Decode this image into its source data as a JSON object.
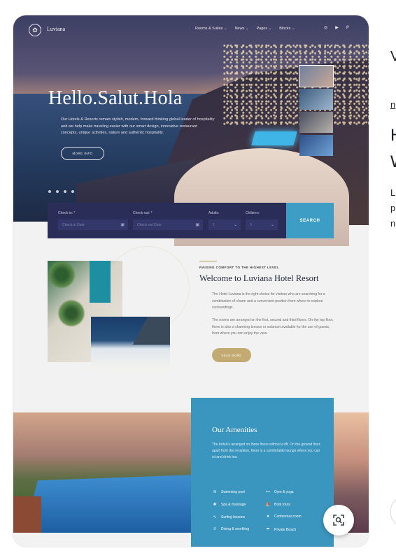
{
  "nav": {
    "logo": "Luviana",
    "items": [
      {
        "label": "Rooms & Suites ⌄"
      },
      {
        "label": "News ⌄"
      },
      {
        "label": "Pages ⌄"
      },
      {
        "label": "Blocks ⌄"
      }
    ]
  },
  "hero": {
    "title": "Hello.Salut.Hola",
    "description": "Our Hotels & Resorts remain stylish, modern, forward thinking global leader of hospitality and we help make traveling easier with our smart design, innovative restaurant concepts, unique activities, nature and authentic hospitality.",
    "more_button": "MORE INFO"
  },
  "booking": {
    "checkin_label": "Check-in: *",
    "checkin_placeholder": "Check-in Date",
    "checkout_label": "Check-out: *",
    "checkout_placeholder": "Check-out Date",
    "adults_label": "Adults:",
    "adults_value": "1",
    "children_label": "Children:",
    "children_value": "0",
    "search_button": "SEARCH"
  },
  "welcome": {
    "eyebrow": "RAISING COMFORT TO THE HIGHEST LEVEL",
    "title": "Welcome to Luviana Hotel Resort",
    "p1": "The Hotel Luviana is the right choice for visitors who are searching for a combination of charm and a convenient position from where to explore surroundings.",
    "p2": "The rooms are arranged on the first, second and third floors. On the top floor, there is also a charming terrace or solarium available for the use of guests, from where you can enjoy the view.",
    "button": "READ MORE"
  },
  "amenities": {
    "title": "Our Amenities",
    "description": "The hotel is arranged on three floors without a lift. On the ground floor, apart from the reception, there is a comfortable lounge where you can sit and drink tea.",
    "items": [
      {
        "label": "Swimming pool",
        "icon": "pool-icon"
      },
      {
        "label": "Gym & yoga",
        "icon": "dumbbell-icon"
      },
      {
        "label": "Spa & massage",
        "icon": "spa-icon"
      },
      {
        "label": "Boat tours",
        "icon": "boat-icon"
      },
      {
        "label": "Surfing lessons",
        "icon": "surf-icon"
      },
      {
        "label": "Conference room",
        "icon": "mic-icon"
      },
      {
        "label": "Diving & snorkling",
        "icon": "diving-icon"
      },
      {
        "label": "Private Beach",
        "icon": "umbrella-icon"
      }
    ]
  },
  "right_panel": {
    "line1": "V",
    "line2": "n",
    "line3": "H",
    "line4": "W",
    "line5": "L",
    "line6": "p",
    "line7": "n"
  },
  "colors": {
    "accent_blue": "#3e9dc4",
    "booking_navy": "#2a2d57",
    "gold": "#c3aa72"
  }
}
